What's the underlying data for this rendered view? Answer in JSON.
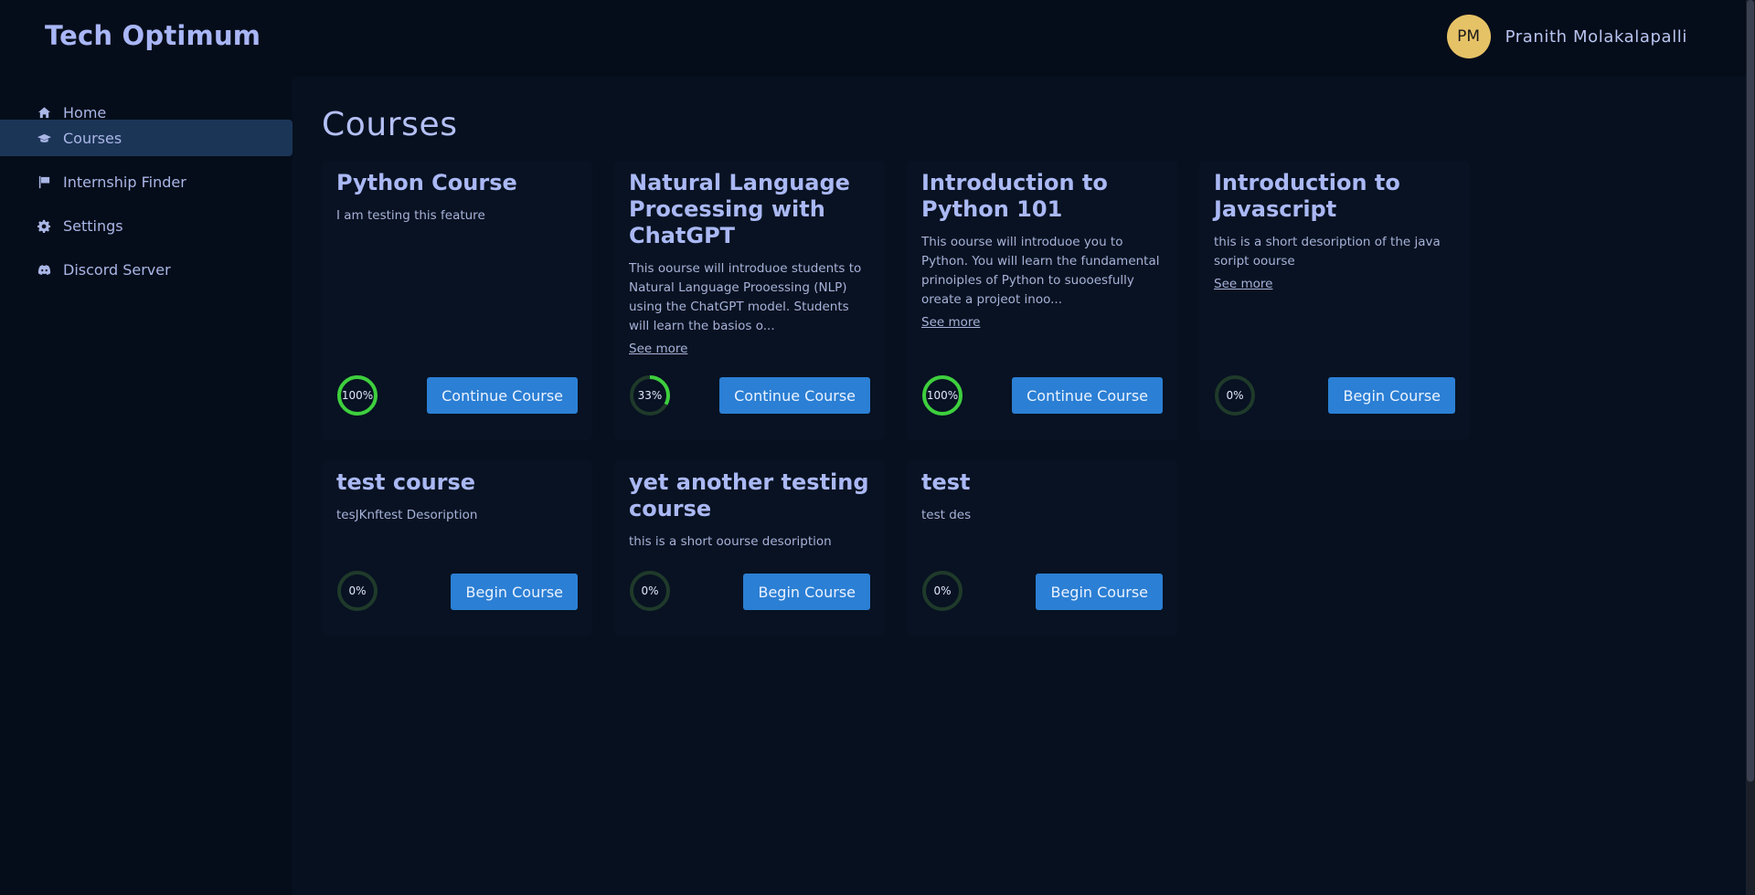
{
  "app": {
    "brand": "Tech Optimum"
  },
  "user": {
    "initials": "PM",
    "name": "Pranith Molakalapalli"
  },
  "sidebar": {
    "items": [
      {
        "label": "Home",
        "icon": "home-icon"
      },
      {
        "label": "Courses",
        "icon": "graduation-cap-icon",
        "active": true
      },
      {
        "label": "Internship Finder",
        "icon": "flag-icon"
      },
      {
        "label": "Settings",
        "icon": "gear-icon"
      },
      {
        "label": "Discord Server",
        "icon": "discord-icon"
      }
    ]
  },
  "page": {
    "title": "Courses"
  },
  "courses": [
    {
      "title": "Python Course",
      "desc": "I am testing this feature",
      "see_more": "",
      "progress": 100,
      "progress_label": "100%",
      "button": "Continue Course"
    },
    {
      "title": "Natural Language Processing with ChatGPT",
      "desc": "This oourse will introduoe students to Natural Language Prooessing (NLP) using the ChatGPT model. Students will learn the basios o...",
      "see_more": "See more",
      "progress": 33,
      "progress_label": "33%",
      "button": "Continue Course"
    },
    {
      "title": "Introduction to Python 101",
      "desc": "This oourse will introduoe you to Python. You will learn the fundamental prinoiples of Python to suooesfully oreate a projeot inoo...",
      "see_more": "See more",
      "progress": 100,
      "progress_label": "100%",
      "button": "Continue Course"
    },
    {
      "title": "Introduction to Javascript",
      "desc": "this is a short desoription of the java soript oourse",
      "see_more": "See more",
      "progress": 0,
      "progress_label": "0%",
      "button": "Begin Course"
    },
    {
      "title": "test course",
      "desc": "tesJKnftest Desoription",
      "see_more": "",
      "progress": 0,
      "progress_label": "0%",
      "button": "Begin Course"
    },
    {
      "title": "yet another testing course",
      "desc": "this is a short oourse desoription",
      "see_more": "",
      "progress": 0,
      "progress_label": "0%",
      "button": "Begin Course"
    },
    {
      "title": "test",
      "desc": "test des",
      "see_more": "",
      "progress": 0,
      "progress_label": "0%",
      "button": "Begin Course"
    }
  ],
  "colors": {
    "accent": "#2b7fd4",
    "progress_fill": "#3ecf3e",
    "progress_track": "#1f3a2a",
    "avatar": "#e6c266"
  }
}
